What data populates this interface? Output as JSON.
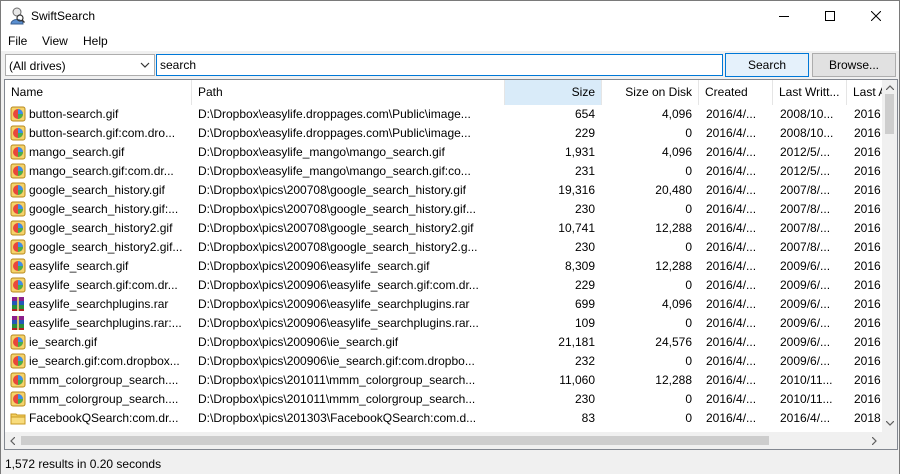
{
  "window": {
    "title": "SwiftSearch"
  },
  "menu": [
    "File",
    "View",
    "Help"
  ],
  "toolbar": {
    "drive_value": "(All drives)",
    "search_value": "search",
    "search_button": "Search",
    "browse_button": "Browse..."
  },
  "columns": {
    "name": "Name",
    "path": "Path",
    "size": "Size",
    "size_on_disk": "Size on Disk",
    "created": "Created",
    "last_written": "Last Writt...",
    "last_accessed": "Last A"
  },
  "sorted_column": "size",
  "rows": [
    {
      "icon": "gif-icon",
      "name": "button-search.gif",
      "path": "D:\\Dropbox\\easylife.droppages.com\\Public\\image...",
      "size": "654",
      "disk": "4,096",
      "created": "2016/4/...",
      "written": "2008/10...",
      "accessed": "2016"
    },
    {
      "icon": "gif-icon",
      "name": "button-search.gif:com.dro...",
      "path": "D:\\Dropbox\\easylife.droppages.com\\Public\\image...",
      "size": "229",
      "disk": "0",
      "created": "2016/4/...",
      "written": "2008/10...",
      "accessed": "2016"
    },
    {
      "icon": "gif-icon",
      "name": "mango_search.gif",
      "path": "D:\\Dropbox\\easylife_mango\\mango_search.gif",
      "size": "1,931",
      "disk": "4,096",
      "created": "2016/4/...",
      "written": "2012/5/...",
      "accessed": "2016"
    },
    {
      "icon": "gif-icon",
      "name": "mango_search.gif:com.dr...",
      "path": "D:\\Dropbox\\easylife_mango\\mango_search.gif:co...",
      "size": "231",
      "disk": "0",
      "created": "2016/4/...",
      "written": "2012/5/...",
      "accessed": "2016"
    },
    {
      "icon": "gif-icon",
      "name": "google_search_history.gif",
      "path": "D:\\Dropbox\\pics\\200708\\google_search_history.gif",
      "size": "19,316",
      "disk": "20,480",
      "created": "2016/4/...",
      "written": "2007/8/...",
      "accessed": "2016"
    },
    {
      "icon": "gif-icon",
      "name": "google_search_history.gif:...",
      "path": "D:\\Dropbox\\pics\\200708\\google_search_history.gif...",
      "size": "230",
      "disk": "0",
      "created": "2016/4/...",
      "written": "2007/8/...",
      "accessed": "2016"
    },
    {
      "icon": "gif-icon",
      "name": "google_search_history2.gif",
      "path": "D:\\Dropbox\\pics\\200708\\google_search_history2.gif",
      "size": "10,741",
      "disk": "12,288",
      "created": "2016/4/...",
      "written": "2007/8/...",
      "accessed": "2016"
    },
    {
      "icon": "gif-icon",
      "name": "google_search_history2.gif...",
      "path": "D:\\Dropbox\\pics\\200708\\google_search_history2.g...",
      "size": "230",
      "disk": "0",
      "created": "2016/4/...",
      "written": "2007/8/...",
      "accessed": "2016"
    },
    {
      "icon": "gif-icon",
      "name": "easylife_search.gif",
      "path": "D:\\Dropbox\\pics\\200906\\easylife_search.gif",
      "size": "8,309",
      "disk": "12,288",
      "created": "2016/4/...",
      "written": "2009/6/...",
      "accessed": "2016"
    },
    {
      "icon": "gif-icon",
      "name": "easylife_search.gif:com.dr...",
      "path": "D:\\Dropbox\\pics\\200906\\easylife_search.gif:com.dr...",
      "size": "229",
      "disk": "0",
      "created": "2016/4/...",
      "written": "2009/6/...",
      "accessed": "2016"
    },
    {
      "icon": "rar-icon",
      "name": "easylife_searchplugins.rar",
      "path": "D:\\Dropbox\\pics\\200906\\easylife_searchplugins.rar",
      "size": "699",
      "disk": "4,096",
      "created": "2016/4/...",
      "written": "2009/6/...",
      "accessed": "2016"
    },
    {
      "icon": "rar-icon",
      "name": "easylife_searchplugins.rar:...",
      "path": "D:\\Dropbox\\pics\\200906\\easylife_searchplugins.rar...",
      "size": "109",
      "disk": "0",
      "created": "2016/4/...",
      "written": "2009/6/...",
      "accessed": "2016"
    },
    {
      "icon": "gif-icon",
      "name": "ie_search.gif",
      "path": "D:\\Dropbox\\pics\\200906\\ie_search.gif",
      "size": "21,181",
      "disk": "24,576",
      "created": "2016/4/...",
      "written": "2009/6/...",
      "accessed": "2016"
    },
    {
      "icon": "gif-icon",
      "name": "ie_search.gif:com.dropbox...",
      "path": "D:\\Dropbox\\pics\\200906\\ie_search.gif:com.dropbo...",
      "size": "232",
      "disk": "0",
      "created": "2016/4/...",
      "written": "2009/6/...",
      "accessed": "2016"
    },
    {
      "icon": "gif-icon",
      "name": "mmm_colorgroup_search....",
      "path": "D:\\Dropbox\\pics\\201011\\mmm_colorgroup_search...",
      "size": "11,060",
      "disk": "12,288",
      "created": "2016/4/...",
      "written": "2010/11...",
      "accessed": "2016"
    },
    {
      "icon": "gif-icon",
      "name": "mmm_colorgroup_search....",
      "path": "D:\\Dropbox\\pics\\201011\\mmm_colorgroup_search...",
      "size": "230",
      "disk": "0",
      "created": "2016/4/...",
      "written": "2010/11...",
      "accessed": "2016"
    },
    {
      "icon": "folder-file-icon",
      "name": "FacebookQSearch:com.dr...",
      "path": "D:\\Dropbox\\pics\\201303\\FacebookQSearch:com.d...",
      "size": "83",
      "disk": "0",
      "created": "2016/4/...",
      "written": "2016/4/...",
      "accessed": "2018"
    }
  ],
  "status": "1,572 results in 0.20 seconds"
}
